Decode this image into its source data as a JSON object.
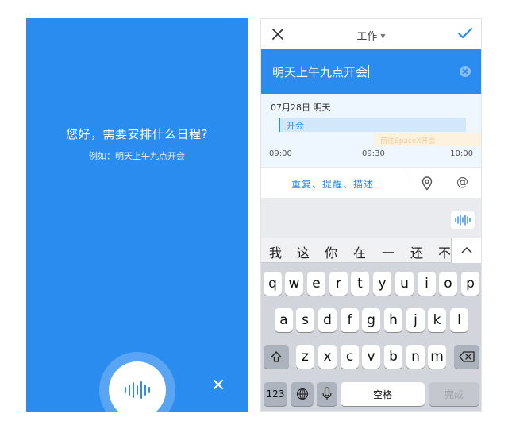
{
  "left_panel": {
    "greeting": "您好，需要安排什么日程?",
    "example": "例如：明天上午九点开会",
    "mic_icon": "voice-wave-icon",
    "close_icon": "close-icon"
  },
  "right_panel": {
    "topbar": {
      "title": "工作",
      "close_icon": "close-icon",
      "confirm_icon": "check-icon"
    },
    "input": {
      "value": "明天上午九点开会"
    },
    "schedule": {
      "date": "07月28日 明天",
      "event": "开会",
      "conflict_event": "前往SpaceX开会",
      "times": [
        "09:00",
        "09:30",
        "10:00"
      ]
    },
    "options": {
      "link": "重复、提醒、描述",
      "location_icon": "location-pin-icon",
      "mention": "@"
    },
    "keyboard": {
      "candidates": [
        "我",
        "这",
        "你",
        "在",
        "一",
        "还",
        "不"
      ],
      "row1": [
        "q",
        "w",
        "e",
        "r",
        "t",
        "y",
        "u",
        "i",
        "o",
        "p"
      ],
      "row2": [
        "a",
        "s",
        "d",
        "f",
        "g",
        "h",
        "j",
        "k",
        "l"
      ],
      "row3": [
        "z",
        "x",
        "c",
        "v",
        "b",
        "n",
        "m"
      ],
      "num_key": "123",
      "space": "空格",
      "done": "完成"
    }
  },
  "colors": {
    "accent": "#2b8cf0",
    "keyboard_bg": "#d2d5db"
  }
}
